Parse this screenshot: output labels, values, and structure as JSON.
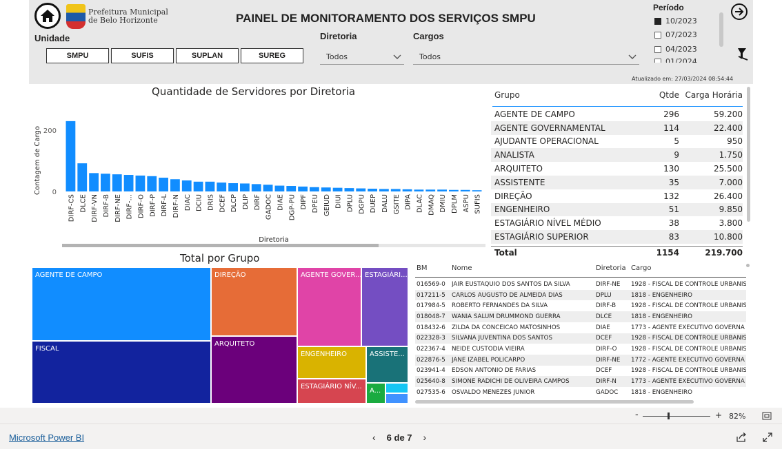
{
  "header": {
    "title": "PAINEL DE MONITORAMENTO DOS SERVIÇOS SMPU",
    "logo_line1": "Prefeitura Municipal",
    "logo_line2": "de Belo Horizonte",
    "unidade_label": "Unidade",
    "unidade_buttons": [
      "SMPU",
      "SUFIS",
      "SUPLAN",
      "SUREG"
    ],
    "diretoria_label": "Diretoria",
    "diretoria_value": "Todos",
    "cargos_label": "Cargos",
    "cargos_value": "Todos",
    "periodo_label": "Período",
    "periodo_items": [
      {
        "label": "10/2023",
        "checked": true
      },
      {
        "label": "07/2023",
        "checked": false
      },
      {
        "label": "04/2023",
        "checked": false
      },
      {
        "label": "01/2024",
        "checked": false
      }
    ],
    "updated": "Atualizado em: 27/03/2024 08:54:44"
  },
  "bar_chart": {
    "title": "Quantidade de Servidores por Diretoria",
    "xlabel": "Diretoria",
    "ylabel": "Contagem de Cargo"
  },
  "chart_data": {
    "type": "bar",
    "title": "Quantidade de Servidores por Diretoria",
    "xlabel": "Diretoria",
    "ylabel": "Contagem de Cargo",
    "categories": [
      "DIRF-CS",
      "DLCE",
      "DIRF-VN",
      "DIRF-B",
      "DIRF-NE",
      "DIRF-...",
      "DIRF-O",
      "DIRF-P",
      "DIRF-L",
      "DIRF-N",
      "DIAC",
      "DCIU",
      "DRIS",
      "DCEF",
      "DLCP",
      "DLIP",
      "DIRF",
      "GADOC",
      "DIAE",
      "DGP-PU",
      "DIPF",
      "DPEU",
      "GEIUD",
      "DIUI",
      "DPLU",
      "DGPU",
      "DUEP",
      "DALU",
      "GSITE",
      "DIPA",
      "DLAC",
      "DMAQ",
      "DMIU",
      "DPLM",
      "ASPU",
      "SUFIS"
    ],
    "values": [
      230,
      92,
      60,
      58,
      56,
      54,
      52,
      50,
      45,
      40,
      36,
      32,
      32,
      29,
      27,
      26,
      24,
      22,
      19,
      18,
      16,
      14,
      13,
      12,
      11,
      10,
      9,
      8,
      8,
      7,
      6,
      6,
      6,
      5,
      5,
      4
    ],
    "ylim": [
      0,
      250
    ],
    "yticks": [
      0,
      200
    ]
  },
  "treemap": {
    "title": "Total por Grupo",
    "cells": [
      {
        "label": "AGENTE DE CAMPO",
        "color": "#118DFF"
      },
      {
        "label": "FISCAL",
        "color": "#12239E"
      },
      {
        "label": "DIREÇÃO",
        "color": "#E66C37"
      },
      {
        "label": "ARQUITETO",
        "color": "#6B007B"
      },
      {
        "label": "AGENTE GOVER...",
        "color": "#E044A7"
      },
      {
        "label": "ESTAGIÁRI...",
        "color": "#744EC2"
      },
      {
        "label": "ENGENHEIRO",
        "color": "#D9B300"
      },
      {
        "label": "ASSISTE...",
        "color": "#197278"
      },
      {
        "label": "ESTAGIÁRIO NÍV...",
        "color": "#D64550"
      },
      {
        "label": "A...",
        "color": "#1AAB40"
      },
      {
        "label": "",
        "color": "#15C6F4"
      },
      {
        "label": "",
        "color": "#4092FF"
      },
      {
        "label": "",
        "color": "#FFA058"
      }
    ]
  },
  "grupo_table": {
    "headers": [
      "Grupo",
      "Qtde",
      "Carga Horária"
    ],
    "rows": [
      [
        "AGENTE DE CAMPO",
        "296",
        "59.200"
      ],
      [
        "AGENTE GOVERNAMENTAL",
        "114",
        "22.400"
      ],
      [
        "AJUDANTE OPERACIONAL",
        "5",
        "950"
      ],
      [
        "ANALISTA",
        "9",
        "1.750"
      ],
      [
        "ARQUITETO",
        "130",
        "25.500"
      ],
      [
        "ASSISTENTE",
        "35",
        "7.000"
      ],
      [
        "DIREÇÃO",
        "132",
        "26.400"
      ],
      [
        "ENGENHEIRO",
        "51",
        "9.850"
      ],
      [
        "ESTAGIÁRIO NÍVEL MÉDIO",
        "38",
        "3.800"
      ],
      [
        "ESTAGIÁRIO SUPERIOR",
        "83",
        "10.800"
      ]
    ],
    "total": [
      "Total",
      "1154",
      "219.700"
    ]
  },
  "bm_table": {
    "headers": [
      "BM",
      "Nome",
      "Diretoria",
      "Cargo"
    ],
    "rows": [
      [
        "016569-0",
        "JAIR EUSTAQUIO DOS SANTOS DA SILVA",
        "DIRF-NE",
        "1928 - FISCAL DE CONTROLE URBANIS"
      ],
      [
        "017211-5",
        "CARLOS AUGUSTO DE ALMEIDA DIAS",
        "DPLU",
        "1818 - ENGENHEIRO"
      ],
      [
        "017984-5",
        "ROBERTO FERNANDES DA SILVA",
        "DIRF-B",
        "1928 - FISCAL DE CONTROLE URBANIS"
      ],
      [
        "018048-7",
        "WANIA SALUM DRUMMOND GUERRA",
        "DLCE",
        "1818 - ENGENHEIRO"
      ],
      [
        "018432-6",
        "ZILDA DA CONCEICAO MATOSINHOS",
        "DIAE",
        "1773 - AGENTE EXECUTIVO GOVERNA"
      ],
      [
        "022328-3",
        "SILVANA JUVENTINA DOS SANTOS",
        "DCEF",
        "1928 - FISCAL DE CONTROLE URBANIS"
      ],
      [
        "022367-4",
        "NEIDE CUSTODIA VIEIRA",
        "DIRF-O",
        "1928 - FISCAL DE CONTROLE URBANIS"
      ],
      [
        "022876-5",
        "JANE IZABEL POLICARPO",
        "DIRF-NE",
        "1772 - AGENTE EXECUTIVO GOVERNA"
      ],
      [
        "023941-4",
        "EDSON ANTONIO DE FARIAS",
        "DCEF",
        "1928 - FISCAL DE CONTROLE URBANIS"
      ],
      [
        "025640-8",
        "SIMONE RADICHI DE OLIVEIRA CAMPOS",
        "DIRF-N",
        "1773 - AGENTE EXECUTIVO GOVERNA"
      ],
      [
        "027535-6",
        "OSVALDO MENEZES JUNIOR",
        "GADOC",
        "1818 - ENGENHEIRO"
      ]
    ]
  },
  "zoom": {
    "minus": "-",
    "plus": "+",
    "value": "82%"
  },
  "footer": {
    "brand": "Microsoft Power BI",
    "page_indicator": "6 de 7",
    "prev": "‹",
    "next": "›"
  },
  "colors": {
    "bar": "#118DFF",
    "header_bg": "#E8E8E8",
    "link": "#1A5E9A"
  }
}
